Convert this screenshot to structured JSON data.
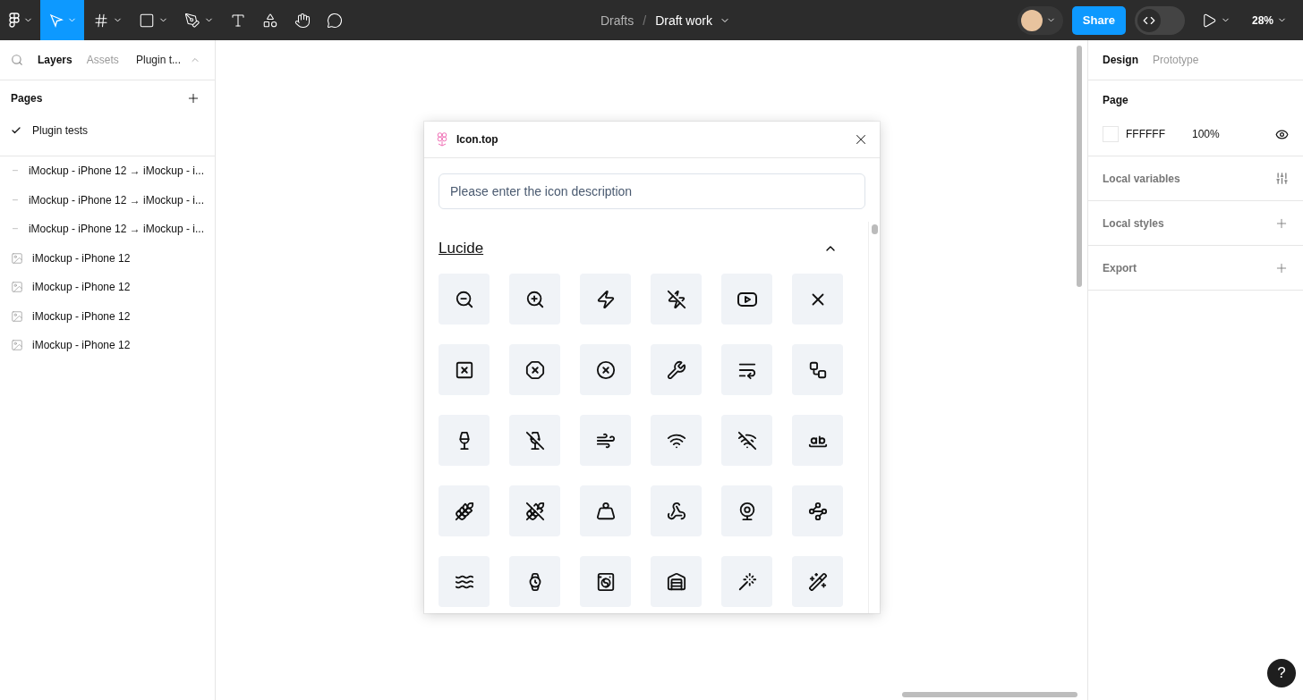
{
  "toolbar": {
    "tools": [
      {
        "kind": "logo",
        "selected": false,
        "menu": true
      },
      {
        "kind": "move",
        "selected": true,
        "menu": true
      },
      {
        "kind": "frame",
        "selected": false,
        "menu": true
      },
      {
        "kind": "shape",
        "selected": false,
        "menu": true
      },
      {
        "kind": "pen",
        "selected": false,
        "menu": true
      },
      {
        "kind": "text",
        "selected": false,
        "menu": false
      },
      {
        "kind": "resources",
        "selected": false,
        "menu": false
      },
      {
        "kind": "hand",
        "selected": false,
        "menu": false
      },
      {
        "kind": "comment",
        "selected": false,
        "menu": false
      }
    ],
    "breadcrumb": {
      "folder": "Drafts",
      "separator": "/",
      "file": "Draft work"
    },
    "share": "Share",
    "dev_mode": {
      "on": false
    },
    "zoom": "28%"
  },
  "left_panel": {
    "tabs": [
      {
        "label": "Layers",
        "selected": true
      },
      {
        "label": "Assets",
        "selected": false
      }
    ],
    "page_selector": "Plugin t...",
    "pages_title": "Pages",
    "pages": [
      {
        "label": "Plugin tests",
        "selected": true
      }
    ],
    "layers": [
      {
        "kind": "connector",
        "label": "iMockup - iPhone 12 → iMockup - i..."
      },
      {
        "kind": "connector",
        "label": "iMockup - iPhone 12 → iMockup - i..."
      },
      {
        "kind": "connector",
        "label": "iMockup - iPhone 12 → iMockup - i..."
      },
      {
        "kind": "image",
        "label": "iMockup - iPhone 12"
      },
      {
        "kind": "image",
        "label": "iMockup - iPhone 12"
      },
      {
        "kind": "image",
        "label": "iMockup - iPhone 12"
      },
      {
        "kind": "image",
        "label": "iMockup - iPhone 12"
      }
    ]
  },
  "plugin": {
    "title": "Icon.top",
    "search": {
      "placeholder": "Please enter the icon description"
    },
    "section": {
      "title": "Lucide",
      "expanded": true
    }
  },
  "right_panel": {
    "tabs": [
      {
        "label": "Design",
        "selected": true
      },
      {
        "label": "Prototype",
        "selected": false
      }
    ],
    "page": {
      "title": "Page",
      "color": "FFFFFF",
      "opacity": "100%"
    },
    "sections": [
      {
        "kind": "variables",
        "label": "Local variables"
      },
      {
        "kind": "add",
        "label": "Local styles"
      },
      {
        "kind": "add",
        "label": "Export"
      }
    ]
  },
  "help": "?"
}
